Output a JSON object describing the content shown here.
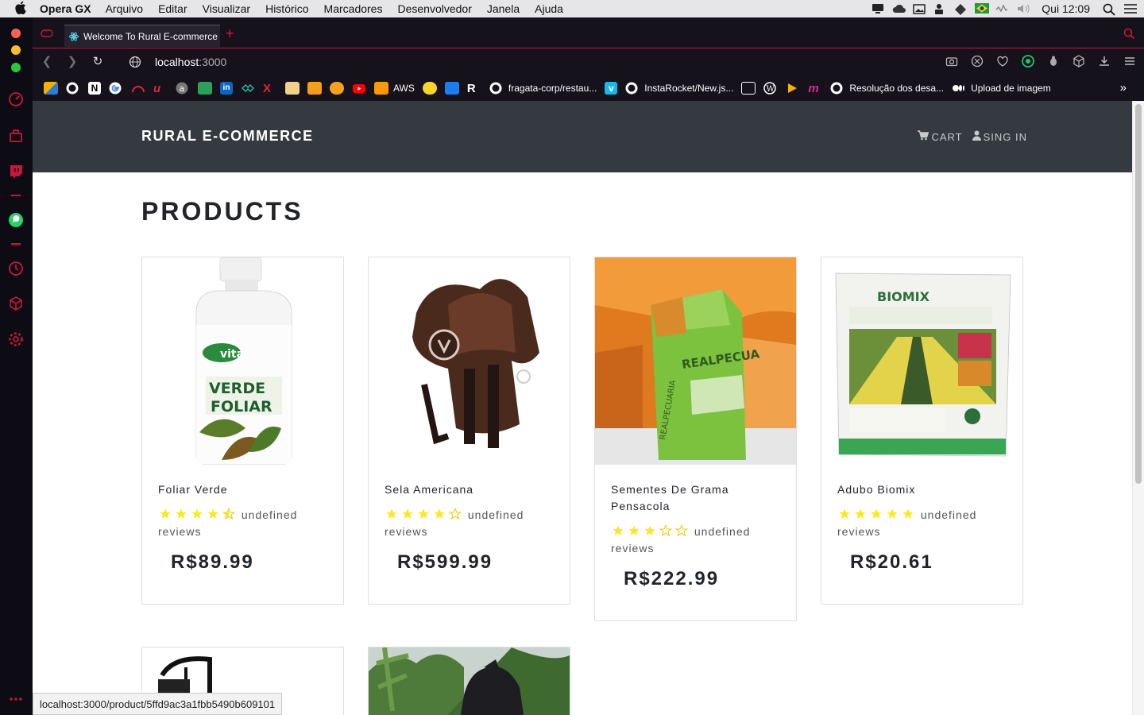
{
  "menubar": {
    "app_name": "Opera GX",
    "items": [
      "Arquivo",
      "Editar",
      "Visualizar",
      "Histórico",
      "Marcadores",
      "Desenvolvedor",
      "Janela",
      "Ajuda"
    ],
    "clock": "Qui 12:09"
  },
  "browser": {
    "tab_title": "Welcome To Rural E-commerce",
    "new_tab_label": "+",
    "url_host": "localhost",
    "url_port": ":3000",
    "bookmarks": {
      "aws": "AWS",
      "fragata": "fragata-corp/restau...",
      "instarocket": "InstaRocket/New.js...",
      "resolucao": "Resolução dos desa...",
      "upload": "Upload de imagem",
      "more": "»"
    }
  },
  "site": {
    "brand": "RURAL E-COMMERCE",
    "cart_label": "CART",
    "signin_label": "SING IN",
    "page_title": "PRODUCTS",
    "products": [
      {
        "name": "Foliar Verde",
        "rating": 4.5,
        "reviews_text": "undefined reviews",
        "price": "R$89.99"
      },
      {
        "name": "Sela Americana",
        "rating": 4,
        "reviews_text": "undefined reviews",
        "price": "R$599.99"
      },
      {
        "name": "Sementes De Grama Pensacola",
        "rating": 3,
        "reviews_text": "undefined reviews",
        "price": "R$222.99"
      },
      {
        "name": "Adubo Biomix",
        "rating": 5,
        "reviews_text": "undefined reviews",
        "price": "R$20.61"
      }
    ]
  },
  "status_url": "localhost:3000/product/5ffd9ac3a1fbb5490b609101",
  "colors": {
    "accent": "#c7183b",
    "navbar": "#343a40",
    "star": "#f8e825"
  }
}
